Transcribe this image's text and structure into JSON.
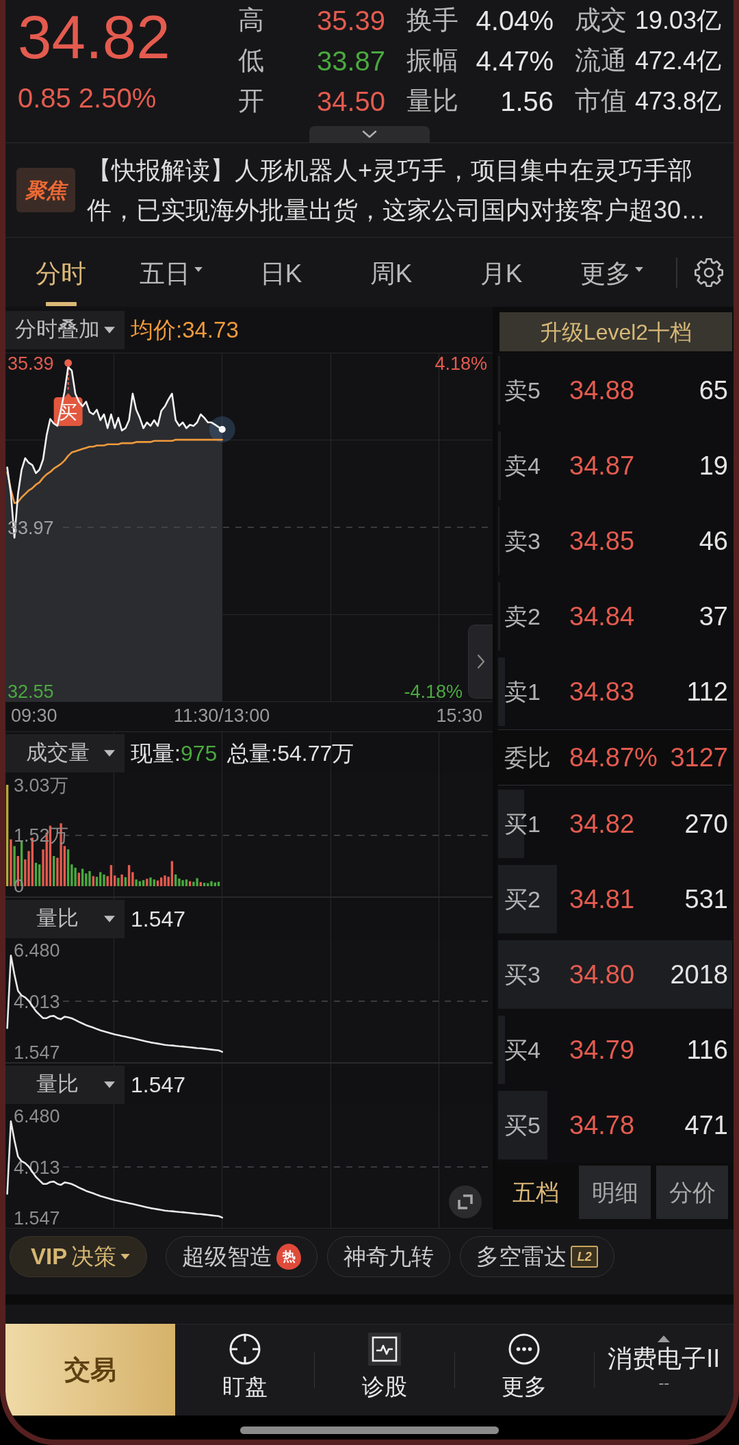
{
  "quote": {
    "price": "34.82",
    "change": "0.85",
    "change_pct": "2.50%",
    "up": true
  },
  "stats": [
    [
      {
        "label": "高",
        "value": "35.39",
        "color": "#e45b4f"
      },
      {
        "label": "换手",
        "value": "4.04%",
        "color": "#e6e6e6"
      },
      {
        "label": "成交",
        "value": "19.03亿",
        "color": "#e6e6e6"
      }
    ],
    [
      {
        "label": "低",
        "value": "33.87",
        "color": "#4aa93f"
      },
      {
        "label": "振幅",
        "value": "4.47%",
        "color": "#e6e6e6"
      },
      {
        "label": "流通",
        "value": "472.4亿",
        "color": "#e6e6e6"
      }
    ],
    [
      {
        "label": "开",
        "value": "34.50",
        "color": "#e45b4f"
      },
      {
        "label": "量比",
        "value": "1.56",
        "color": "#e6e6e6"
      },
      {
        "label": "市值",
        "value": "473.8亿",
        "color": "#e6e6e6"
      }
    ]
  ],
  "news": {
    "badge": "聚焦",
    "text": "【快报解读】人形机器人+灵巧手，项目集中在灵巧手部件，已实现海外批量出货，这家公司国内对接客户超30…"
  },
  "tabs": [
    {
      "label": "分时",
      "selected": true,
      "dropdown": false
    },
    {
      "label": "五日",
      "selected": false,
      "dropdown": true
    },
    {
      "label": "日K",
      "selected": false,
      "dropdown": false
    },
    {
      "label": "周K",
      "selected": false,
      "dropdown": false
    },
    {
      "label": "月K",
      "selected": false,
      "dropdown": false
    },
    {
      "label": "更多",
      "selected": false,
      "dropdown": true
    }
  ],
  "price_panel": {
    "overlay_menu": "分时叠加",
    "average": "均价:34.73",
    "pct_high": "4.18%",
    "pct_low": "-4.18%",
    "time_axis": [
      "09:30",
      "11:30/13:00",
      "15:30"
    ],
    "chart_data": {
      "type": "line",
      "categories": [
        null,
        null,
        null,
        null,
        null,
        null,
        null,
        null,
        null,
        null,
        null,
        null,
        null,
        null,
        null,
        null,
        null,
        null,
        null,
        null,
        null,
        null,
        null,
        null,
        null,
        null,
        null,
        null,
        null,
        null,
        null,
        null,
        null,
        null,
        null,
        null,
        null,
        null,
        null,
        null,
        null,
        null,
        null,
        null,
        null,
        null,
        null,
        null,
        null,
        null,
        null,
        null,
        null,
        null,
        null,
        null,
        null,
        null,
        null,
        null,
        null,
        null,
        null,
        null,
        null,
        null,
        null,
        null,
        null,
        null,
        null,
        null,
        null,
        null,
        null,
        null,
        null,
        null,
        null,
        null,
        null,
        null,
        null,
        null,
        null,
        null,
        null,
        null,
        null,
        null,
        null,
        null,
        null,
        null,
        null,
        null,
        null,
        null,
        null,
        null,
        null,
        null,
        null,
        null,
        null,
        null,
        null,
        null,
        null,
        null,
        null,
        null,
        null,
        null,
        null,
        null,
        null,
        null,
        null,
        null,
        null,
        null,
        null,
        null,
        null,
        null,
        null,
        null,
        null,
        null,
        null,
        null,
        null,
        null,
        null,
        null
      ],
      "series": [
        {
          "color": "#f2f2f2",
          "values": [
            34.49,
            34.26,
            33.88,
            34.26,
            34.47,
            34.57,
            34.53,
            34.51,
            34.44,
            34.47,
            34.56,
            34.77,
            34.91,
            34.87,
            34.85,
            34.99,
            35.15,
            35.36,
            35.33,
            35.13,
            35.06,
            35.02,
            35.06,
            34.97,
            34.95,
            34.99,
            34.9,
            34.95,
            34.83,
            34.95,
            34.83,
            34.92,
            34.81,
            34.83,
            34.9,
            35.13,
            34.99,
            34.92,
            34.83,
            34.88,
            34.85,
            34.9,
            34.85,
            34.98,
            35.02,
            35.08,
            35.13,
            34.9,
            34.85,
            34.88,
            34.83,
            34.86,
            34.85,
            34.88,
            34.95,
            34.92,
            34.88,
            34.88,
            34.86,
            34.84,
            34.82,
            null,
            null,
            null,
            null,
            null,
            null,
            null,
            null,
            null,
            null,
            null,
            null,
            null,
            null,
            null,
            null,
            null,
            null,
            null,
            null,
            null,
            null,
            null,
            null,
            null,
            null,
            null,
            null,
            null,
            null,
            null,
            null,
            null,
            null,
            null,
            null,
            null,
            null,
            null,
            null,
            null,
            null,
            null,
            null,
            null,
            null,
            null,
            null,
            null,
            null,
            null,
            null,
            null,
            null,
            null,
            null,
            null,
            null,
            null,
            null,
            null,
            null,
            null,
            null,
            null,
            null,
            null,
            null,
            null,
            null,
            null,
            null,
            null,
            null,
            null
          ]
        },
        {
          "color": "#ef9a3c",
          "values": [
            34.45,
            34.3,
            34.18,
            34.19,
            34.23,
            34.26,
            34.29,
            34.31,
            34.34,
            34.36,
            34.4,
            34.43,
            34.45,
            34.48,
            34.5,
            34.52,
            34.55,
            34.59,
            34.62,
            34.63,
            34.64,
            34.65,
            34.66,
            34.67,
            34.67,
            34.68,
            34.68,
            34.68,
            34.69,
            34.69,
            34.69,
            34.69,
            34.7,
            34.7,
            34.7,
            34.7,
            34.71,
            34.71,
            34.71,
            34.71,
            34.71,
            34.72,
            34.72,
            34.72,
            34.72,
            34.72,
            34.72,
            34.73,
            34.73,
            34.73,
            34.73,
            34.73,
            34.73,
            34.73,
            34.73,
            34.73,
            34.73,
            34.73,
            34.73,
            34.73,
            34.73,
            null,
            null,
            null,
            null,
            null,
            null,
            null,
            null,
            null,
            null,
            null,
            null,
            null,
            null,
            null,
            null,
            null,
            null,
            null,
            null,
            null,
            null,
            null,
            null,
            null,
            null,
            null,
            null,
            null,
            null,
            null,
            null,
            null,
            null,
            null,
            null,
            null,
            null,
            null,
            null,
            null,
            null,
            null,
            null,
            null,
            null,
            null,
            null,
            null,
            null,
            null,
            null,
            null,
            null,
            null,
            null,
            null,
            null,
            null,
            null,
            null,
            null,
            null,
            null,
            null,
            null,
            null,
            null,
            null,
            null,
            null,
            null,
            null,
            null,
            null
          ]
        }
      ],
      "ylim": [
        32.455,
        35.485
      ],
      "yticks": [
        32.55,
        33.97,
        35.39
      ],
      "ref_lines": [
        {
          "axis": "y",
          "value": 33.97
        }
      ],
      "annotations": [
        "买"
      ]
    }
  },
  "volume_panel": {
    "menu": "成交量",
    "current_label": "现量:",
    "current_value": "975",
    "current_up": false,
    "total": "总量:54.77万",
    "chart_data": {
      "type": "bar",
      "categories": [
        null,
        null,
        null,
        null,
        null,
        null,
        null,
        null,
        null,
        null,
        null,
        null,
        null,
        null,
        null,
        null,
        null,
        null,
        null,
        null,
        null,
        null,
        null,
        null,
        null,
        null,
        null,
        null,
        null,
        null,
        null,
        null,
        null,
        null,
        null,
        null,
        null,
        null,
        null,
        null,
        null,
        null,
        null,
        null,
        null,
        null,
        null,
        null,
        null,
        null,
        null,
        null,
        null,
        null,
        null,
        null,
        null,
        null,
        null,
        null,
        null,
        null,
        null,
        null,
        null,
        null,
        null,
        null,
        null,
        null,
        null,
        null,
        null,
        null,
        null,
        null,
        null,
        null,
        null,
        null,
        null,
        null,
        null,
        null,
        null,
        null,
        null,
        null,
        null,
        null,
        null,
        null,
        null,
        null,
        null,
        null,
        null,
        null,
        null,
        null,
        null,
        null,
        null,
        null,
        null,
        null,
        null,
        null,
        null,
        null,
        null,
        null,
        null,
        null,
        null,
        null,
        null,
        null,
        null,
        null,
        null,
        null,
        null,
        null,
        null,
        null,
        null,
        null,
        null,
        null,
        null,
        null,
        null,
        null,
        null,
        null
      ],
      "series": [
        {
          "color": "#b8a93a",
          "values": [
            3.03,
            null,
            null,
            null,
            null,
            null,
            null,
            null,
            null,
            null,
            null,
            null,
            null,
            null,
            null,
            null,
            null,
            null,
            null,
            null,
            null,
            null,
            null,
            null,
            null,
            null,
            null,
            null,
            null,
            null,
            null,
            null,
            null,
            null,
            null,
            null,
            null,
            null,
            null,
            null,
            null,
            null,
            null,
            null,
            null,
            null,
            null,
            null,
            null,
            null,
            null,
            null,
            null,
            null,
            null,
            null,
            null,
            null,
            null,
            null,
            null,
            null,
            null,
            null,
            null,
            null,
            null,
            null,
            null,
            null,
            null,
            null,
            null,
            null,
            null,
            null,
            null,
            null,
            null,
            null,
            null,
            null,
            null,
            null,
            null,
            null,
            null,
            null,
            null,
            null,
            null,
            null,
            null,
            null,
            null,
            null,
            null,
            null,
            null,
            null,
            null,
            null,
            null,
            null,
            null,
            null,
            null,
            null,
            null,
            null,
            null,
            null,
            null,
            null,
            null,
            null,
            null,
            null,
            null,
            null,
            null,
            null,
            null,
            null,
            null,
            null,
            null,
            null,
            null,
            null,
            null,
            null,
            null,
            null,
            null,
            null
          ]
        },
        {
          "color": "#e45b4f",
          "values": [
            null,
            1.4,
            null,
            0.9,
            null,
            0.8,
            1.05,
            1.45,
            null,
            null,
            1.1,
            1.6,
            1.81,
            null,
            0.85,
            1.88,
            1.2,
            null,
            null,
            null,
            0.4,
            null,
            null,
            null,
            0.3,
            null,
            null,
            null,
            0.3,
            0.63,
            0.32,
            null,
            0.35,
            null,
            0.63,
            0.42,
            null,
            null,
            null,
            0.22,
            null,
            null,
            0.17,
            0.26,
            0.32,
            0.28,
            0.75,
            null,
            null,
            null,
            null,
            0.15,
            null,
            null,
            0.12,
            null,
            null,
            null,
            null,
            null,
            null,
            null,
            null,
            null,
            null,
            null,
            null,
            null,
            null,
            null,
            null,
            null,
            null,
            null,
            null,
            null,
            null,
            null,
            null,
            null,
            null,
            null,
            null,
            null,
            null,
            null,
            null,
            null,
            null,
            null,
            null,
            null,
            null,
            null,
            null,
            null,
            null,
            null,
            null,
            null,
            null,
            null,
            null,
            null,
            null,
            null,
            null,
            null,
            null,
            null,
            null,
            null,
            null,
            null,
            null,
            null,
            null,
            null,
            null,
            null,
            null,
            null,
            null,
            null,
            null,
            null,
            null,
            null,
            null,
            null,
            null,
            null,
            null,
            null,
            null,
            null
          ]
        },
        {
          "color": "#4aa93f",
          "values": [
            null,
            null,
            1.2,
            null,
            1.35,
            null,
            null,
            null,
            0.7,
            0.65,
            null,
            null,
            null,
            0.9,
            null,
            null,
            null,
            1.1,
            0.65,
            0.55,
            null,
            0.52,
            0.38,
            0.45,
            null,
            0.28,
            0.42,
            0.35,
            null,
            null,
            null,
            0.25,
            null,
            0.27,
            null,
            null,
            0.2,
            0.15,
            0.18,
            null,
            0.26,
            0.2,
            null,
            null,
            null,
            null,
            null,
            0.35,
            0.23,
            0.18,
            0.2,
            null,
            0.13,
            0.24,
            null,
            0.1,
            0.09,
            0.15,
            0.11,
            0.13,
            null,
            null,
            null,
            null,
            null,
            null,
            null,
            null,
            null,
            null,
            null,
            null,
            null,
            null,
            null,
            null,
            null,
            null,
            null,
            null,
            null,
            null,
            null,
            null,
            null,
            null,
            null,
            null,
            null,
            null,
            null,
            null,
            null,
            null,
            null,
            null,
            null,
            null,
            null,
            null,
            null,
            null,
            null,
            null,
            null,
            null,
            null,
            null,
            null,
            null,
            null,
            null,
            null,
            null,
            null,
            null,
            null,
            null,
            null,
            null,
            null,
            null,
            null,
            null,
            null,
            null,
            null,
            null,
            null,
            null,
            null,
            null,
            null,
            null,
            null,
            null
          ]
        }
      ],
      "ylim": [
        -0.328,
        3.358
      ],
      "yticks": [
        0,
        {
          "value": 1.52,
          "label": "1.52万"
        },
        {
          "value": 3.03,
          "label": "3.03万"
        }
      ],
      "ref_lines": [
        {
          "axis": "y",
          "value": 1.52
        }
      ]
    }
  },
  "ratio_panels": [
    {
      "menu": "量比",
      "value": "1.547",
      "chart_data": {
        "type": "line",
        "categories": [
          null,
          null,
          null,
          null,
          null,
          null,
          null,
          null,
          null,
          null,
          null,
          null,
          null,
          null,
          null,
          null,
          null,
          null,
          null,
          null,
          null,
          null,
          null,
          null,
          null,
          null,
          null,
          null,
          null,
          null,
          null,
          null,
          null,
          null,
          null,
          null,
          null,
          null,
          null,
          null,
          null,
          null,
          null,
          null,
          null,
          null,
          null,
          null,
          null,
          null,
          null,
          null,
          null,
          null,
          null,
          null,
          null,
          null,
          null,
          null,
          null,
          null,
          null,
          null,
          null,
          null,
          null,
          null,
          null,
          null,
          null,
          null,
          null,
          null,
          null,
          null,
          null,
          null,
          null,
          null,
          null,
          null,
          null,
          null,
          null,
          null,
          null,
          null,
          null,
          null,
          null,
          null,
          null,
          null,
          null,
          null,
          null,
          null,
          null,
          null,
          null,
          null,
          null,
          null,
          null,
          null,
          null,
          null,
          null,
          null,
          null,
          null,
          null,
          null,
          null,
          null,
          null,
          null,
          null,
          null,
          null,
          null,
          null,
          null,
          null,
          null,
          null,
          null,
          null,
          null,
          null,
          null,
          null,
          null,
          null,
          null
        ],
        "series": [
          {
            "color": "#e8e8e8",
            "values": [
              2.71,
              6.24,
              5.31,
              4.52,
              4.29,
              4.2,
              4.03,
              3.78,
              3.53,
              3.36,
              3.19,
              3.19,
              3.28,
              3.3,
              3.19,
              3.14,
              3.26,
              3.23,
              3.18,
              3.1,
              3.01,
              2.93,
              2.85,
              2.79,
              2.73,
              2.66,
              2.6,
              2.55,
              2.5,
              2.45,
              2.4,
              2.36,
              2.32,
              2.29,
              2.25,
              2.21,
              2.17,
              2.13,
              2.09,
              2.05,
              2.01,
              1.98,
              1.95,
              1.92,
              1.89,
              1.87,
              1.86,
              1.84,
              1.82,
              1.81,
              1.79,
              1.77,
              1.75,
              1.73,
              1.72,
              1.7,
              1.68,
              1.66,
              1.64,
              1.62,
              1.55,
              null,
              null,
              null,
              null,
              null,
              null,
              null,
              null,
              null,
              null,
              null,
              null,
              null,
              null,
              null,
              null,
              null,
              null,
              null,
              null,
              null,
              null,
              null,
              null,
              null,
              null,
              null,
              null,
              null,
              null,
              null,
              null,
              null,
              null,
              null,
              null,
              null,
              null,
              null,
              null,
              null,
              null,
              null,
              null,
              null,
              null,
              null,
              null,
              null,
              null,
              null,
              null,
              null,
              null,
              null,
              null,
              null,
              null,
              null,
              null,
              null,
              null,
              null,
              null,
              null,
              null,
              null,
              null,
              null,
              null,
              null,
              null,
              null,
              null,
              null
            ]
          }
        ],
        "ylim": [
          1.014,
          7.013
        ],
        "yticks": [
          {
            "value": 1.547,
            "label": "1.547"
          },
          {
            "value": 4.013,
            "label": "4.013"
          },
          {
            "value": 6.48,
            "label": "6.480"
          }
        ],
        "ref_lines": [
          {
            "axis": "y",
            "value": 4.013
          }
        ]
      }
    },
    {
      "menu": "量比",
      "value": "1.547",
      "chart_data": {
        "type": "line",
        "categories": [
          null,
          null,
          null,
          null,
          null,
          null,
          null,
          null,
          null,
          null,
          null,
          null,
          null,
          null,
          null,
          null,
          null,
          null,
          null,
          null,
          null,
          null,
          null,
          null,
          null,
          null,
          null,
          null,
          null,
          null,
          null,
          null,
          null,
          null,
          null,
          null,
          null,
          null,
          null,
          null,
          null,
          null,
          null,
          null,
          null,
          null,
          null,
          null,
          null,
          null,
          null,
          null,
          null,
          null,
          null,
          null,
          null,
          null,
          null,
          null,
          null,
          null,
          null,
          null,
          null,
          null,
          null,
          null,
          null,
          null,
          null,
          null,
          null,
          null,
          null,
          null,
          null,
          null,
          null,
          null,
          null,
          null,
          null,
          null,
          null,
          null,
          null,
          null,
          null,
          null,
          null,
          null,
          null,
          null,
          null,
          null,
          null,
          null,
          null,
          null,
          null,
          null,
          null,
          null,
          null,
          null,
          null,
          null,
          null,
          null,
          null,
          null,
          null,
          null,
          null,
          null,
          null,
          null,
          null,
          null,
          null,
          null,
          null,
          null,
          null,
          null,
          null,
          null,
          null,
          null,
          null,
          null,
          null,
          null,
          null,
          null
        ],
        "series": [
          {
            "color": "#e8e8e8",
            "values": [
              2.71,
              6.24,
              5.31,
              4.52,
              4.29,
              4.2,
              4.03,
              3.78,
              3.53,
              3.36,
              3.19,
              3.19,
              3.28,
              3.3,
              3.19,
              3.14,
              3.26,
              3.23,
              3.18,
              3.1,
              3.01,
              2.93,
              2.85,
              2.79,
              2.73,
              2.66,
              2.6,
              2.55,
              2.5,
              2.45,
              2.4,
              2.36,
              2.32,
              2.29,
              2.25,
              2.21,
              2.17,
              2.13,
              2.09,
              2.05,
              2.01,
              1.98,
              1.95,
              1.92,
              1.89,
              1.87,
              1.86,
              1.84,
              1.82,
              1.81,
              1.79,
              1.77,
              1.75,
              1.73,
              1.72,
              1.7,
              1.68,
              1.66,
              1.64,
              1.62,
              1.55,
              null,
              null,
              null,
              null,
              null,
              null,
              null,
              null,
              null,
              null,
              null,
              null,
              null,
              null,
              null,
              null,
              null,
              null,
              null,
              null,
              null,
              null,
              null,
              null,
              null,
              null,
              null,
              null,
              null,
              null,
              null,
              null,
              null,
              null,
              null,
              null,
              null,
              null,
              null,
              null,
              null,
              null,
              null,
              null,
              null,
              null,
              null,
              null,
              null,
              null,
              null,
              null,
              null,
              null,
              null,
              null,
              null,
              null,
              null,
              null,
              null,
              null,
              null,
              null,
              null,
              null,
              null,
              null,
              null,
              null,
              null,
              null,
              null,
              null,
              null
            ]
          }
        ],
        "ylim": [
          1.014,
          7.013
        ],
        "yticks": [
          {
            "value": 1.547,
            "label": "1.547"
          },
          {
            "value": 4.013,
            "label": "4.013"
          },
          {
            "value": 6.48,
            "label": "6.480"
          }
        ],
        "ref_lines": [
          {
            "axis": "y",
            "value": 4.013
          }
        ]
      }
    }
  ],
  "order_book": {
    "upgrade": "升级Level2十档",
    "asks": [
      {
        "label": "卖5",
        "price": "34.88",
        "qty": "65",
        "level": 0.01
      },
      {
        "label": "卖4",
        "price": "34.87",
        "qty": "19",
        "level": 0.012
      },
      {
        "label": "卖3",
        "price": "34.85",
        "qty": "46",
        "level": 0.005
      },
      {
        "label": "卖2",
        "price": "34.84",
        "qty": "37",
        "level": 0.01
      },
      {
        "label": "卖1",
        "price": "34.83",
        "qty": "112",
        "level": 0.03
      }
    ],
    "ratio": {
      "label": "委比",
      "pct": "84.87%",
      "diff": "3127"
    },
    "bids": [
      {
        "label": "买1",
        "price": "34.82",
        "qty": "270",
        "level": 0.11
      },
      {
        "label": "买2",
        "price": "34.81",
        "qty": "531",
        "level": 0.25
      },
      {
        "label": "买3",
        "price": "34.80",
        "qty": "2018",
        "level": 1
      },
      {
        "label": "买4",
        "price": "34.79",
        "qty": "116",
        "level": 0.03
      },
      {
        "label": "买5",
        "price": "34.78",
        "qty": "471",
        "level": 0.21
      }
    ],
    "tabs": [
      {
        "label": "五档",
        "selected": true
      },
      {
        "label": "明细",
        "selected": false
      },
      {
        "label": "分价",
        "selected": false
      }
    ]
  },
  "chips": [
    {
      "label": "**VIP**决策",
      "kind": "menu"
    },
    {
      "label": "超级智造",
      "kind": "hot",
      "badge": "热"
    },
    {
      "label": "神奇九转",
      "kind": "plain"
    },
    {
      "label": "多空雷达",
      "kind": "level2",
      "badge": "L2"
    }
  ],
  "bottom_nav": {
    "trade": "交易",
    "items": [
      {
        "label": "盯盘"
      },
      {
        "label": "诊股"
      },
      {
        "label": "更多"
      }
    ],
    "sector": {
      "name": "消费电子II",
      "change": "--"
    }
  }
}
